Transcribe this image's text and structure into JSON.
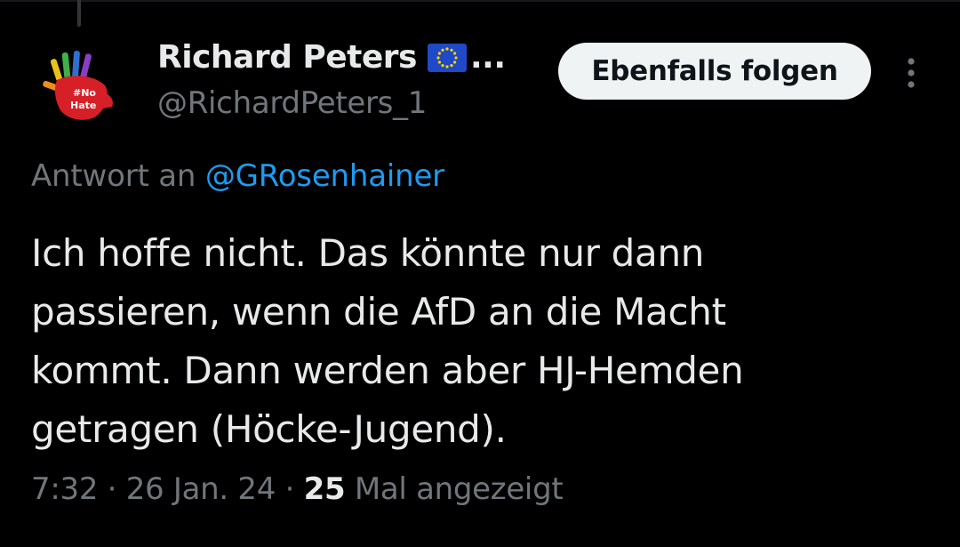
{
  "colors": {
    "background": "#000000",
    "primary_text": "#e7e9ea",
    "secondary_text": "#71767b",
    "link": "#1d9bf0",
    "button_bg": "#eff3f4",
    "button_text": "#0f1419"
  },
  "author": {
    "display_name": "Richard Peters",
    "flag_icon": "eu-flag-icon",
    "ellipsis": "...",
    "handle": "@RichardPeters_1",
    "avatar_text": [
      "#No",
      "Hate"
    ]
  },
  "follow_button": {
    "label": "Ebenfalls folgen"
  },
  "reply": {
    "prefix": "Antwort an",
    "mention": "@GRosenhainer"
  },
  "tweet": {
    "lines": [
      "Ich hoffe nicht. Das könnte nur dann",
      "passieren, wenn die AfD an die Macht",
      "kommt. Dann werden aber HJ-Hemden",
      "getragen (Höcke-Jugend)."
    ]
  },
  "meta": {
    "time": "7:32",
    "separator": "·",
    "date": "26 Jan. 24",
    "views_count": "25",
    "views_label": "Mal angezeigt"
  }
}
